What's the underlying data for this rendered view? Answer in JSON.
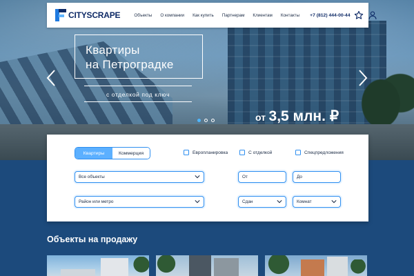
{
  "header": {
    "logo_text": "CITYSCRAPE",
    "nav": [
      {
        "label": "Объекты"
      },
      {
        "label": "О компании"
      },
      {
        "label": "Как купить"
      },
      {
        "label": "Партнерам"
      },
      {
        "label": "Клиентам"
      },
      {
        "label": "Контакты"
      }
    ],
    "phone": "+7 (812) 444-00-44",
    "icons": [
      "star-icon",
      "user-icon"
    ]
  },
  "hero": {
    "title_line1": "Квартиры",
    "title_line2": "на Петроградке",
    "subtitle": "с отделкой под ключ",
    "price_prefix": "от",
    "price_value": "3,5 млн. ₽",
    "slides_total": 3,
    "active_slide": 1
  },
  "filter": {
    "toggle": {
      "active": "Квартиры",
      "inactive": "Коммерция"
    },
    "checkboxes": [
      {
        "label": "Европланировка",
        "checked": false
      },
      {
        "label": "С отделкой",
        "checked": false
      },
      {
        "label": "Спецпредложения",
        "checked": false
      }
    ],
    "objects_select": "Все объекты",
    "location_select": "Район или метро",
    "price_from_placeholder": "От",
    "price_to_placeholder": "До",
    "status_select": "Сдан",
    "rooms_select": "Комнат"
  },
  "section": {
    "title": "Объекты на продажу"
  },
  "colors": {
    "accent": "#2d8ef0",
    "toggle_active": "#5cb0ff",
    "page_bg": "#1c4a7c",
    "brand_dark": "#0e2a66"
  }
}
